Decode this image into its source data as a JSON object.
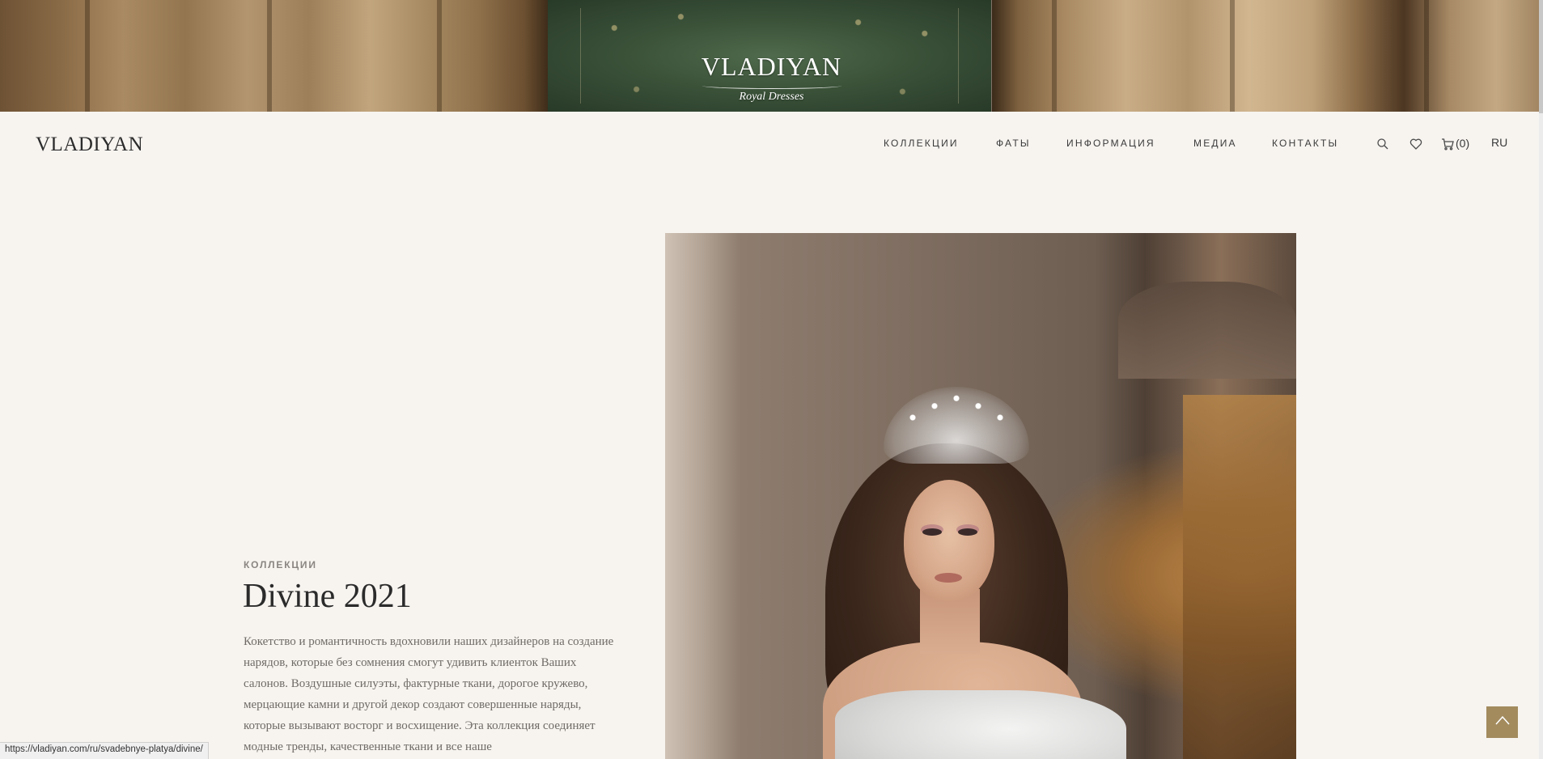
{
  "hero": {
    "logo": "VLADIYAN",
    "tagline": "Royal Dresses"
  },
  "header": {
    "logo": "VLADIYAN",
    "nav": [
      {
        "label": "КОЛЛЕКЦИИ"
      },
      {
        "label": "ФАТЫ"
      },
      {
        "label": "ИНФОРМАЦИЯ"
      },
      {
        "label": "МЕДИА"
      },
      {
        "label": "КОНТАКТЫ"
      }
    ],
    "icons": {
      "search": "search-icon",
      "wishlist": "heart-icon",
      "cart": "cart-icon"
    },
    "cart_count": "(0)",
    "language": "RU"
  },
  "main": {
    "eyebrow": "КОЛЛЕКЦИИ",
    "title": "Divine 2021",
    "description": "Кокетство и романтичность вдохновили наших дизайнеров на создание нарядов, которые без сомнения смогут удивить клиенток Ваших салонов. Воздушные силуэты, фактурные ткани, дорогое кружево, мерцающие камни и другой декор создают совершенные наряды, которые вызывают восторг и восхищение. Эта коллекция соединяет модные тренды, качественные ткани и все наше"
  },
  "status_bar": {
    "url": "https://vladiyan.com/ru/svadebnye-platya/divine/"
  },
  "colors": {
    "background": "#f7f4f0",
    "accent": "#a38b5e",
    "text": "#2b2b2b"
  }
}
